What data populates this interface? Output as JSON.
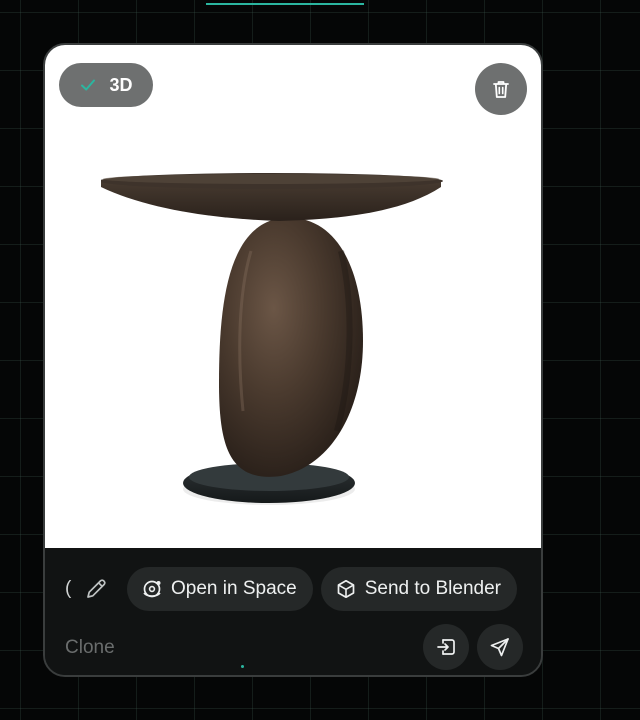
{
  "badge": {
    "label": "3D",
    "icon": "check-icon"
  },
  "toolbar": {
    "truncated_text": "(",
    "open_in_space_label": "Open in Space",
    "send_to_blender_label": "Send to Blender"
  },
  "prompt": {
    "placeholder": "Clone"
  },
  "icons": {
    "trash": "trash-icon",
    "edit": "pencil-icon",
    "open_in_space": "orbit-icon",
    "send_to_blender": "cube-icon",
    "import": "import-icon",
    "send": "send-icon"
  },
  "colors": {
    "accent": "#2bb6a0",
    "card_bg": "#111313",
    "pill_bg": "#252828",
    "badge_bg": "#6e7070",
    "preview_bg": "#ffffff"
  }
}
